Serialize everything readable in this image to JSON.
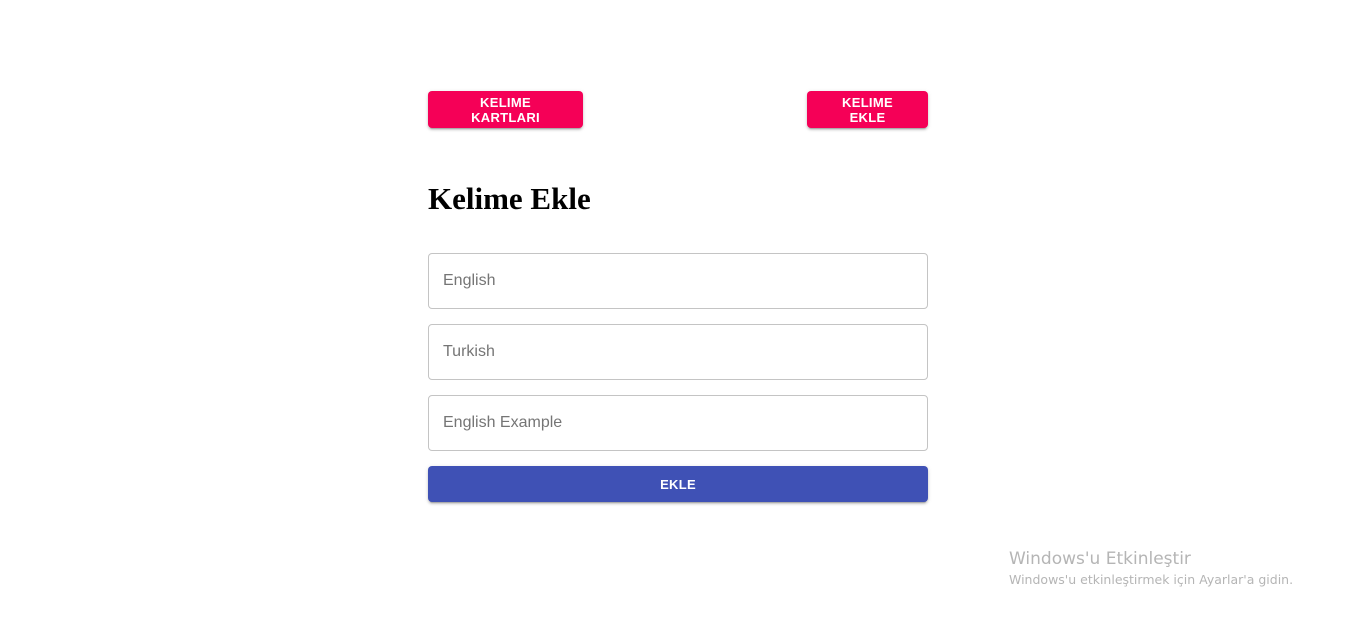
{
  "nav": {
    "cards_button": "KELIME KARTLARI",
    "add_word_button": "KELIME EKLE"
  },
  "form": {
    "title": "Kelime Ekle",
    "english_placeholder": "English",
    "turkish_placeholder": "Turkish",
    "example_placeholder": "English Example",
    "submit_label": "EKLE"
  },
  "colors": {
    "accent_pink": "#f50057",
    "primary_blue": "#3f51b5"
  },
  "watermark": {
    "title": "Windows'u Etkinleştir",
    "subtitle": "Windows'u etkinleştirmek için Ayarlar'a gidin."
  }
}
